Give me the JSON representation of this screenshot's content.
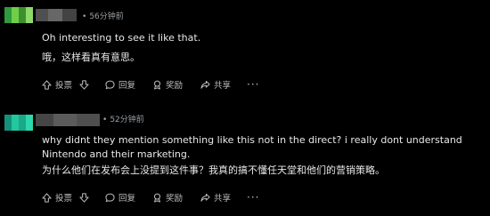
{
  "comments": [
    {
      "time": "56分钟前",
      "text_en": "Oh interesting to see it like that.",
      "text_zh": "哦，这样看真有意思。",
      "avatar_colors": [
        "#37b24d",
        "#6fcf4b",
        "#3e8f2e",
        "#8dd96a"
      ],
      "actions": {
        "upvote": "投票",
        "reply": "回复",
        "award": "奖励",
        "share": "共享",
        "more": "···"
      }
    },
    {
      "time": "52分钟前",
      "text_en": "why didnt they mention something like this not in the direct? i really dont understand Nintendo and their marketing.",
      "text_zh": "为什么他们在发布会上没提到这件事？我真的搞不懂任天堂和他们的营销策略。",
      "avatar_colors": [
        "#1aa88a",
        "#22c79e",
        "#16907a",
        "#2bd9ad"
      ],
      "actions": {
        "upvote": "投票",
        "reply": "回复",
        "award": "奖励",
        "share": "共享",
        "more": "···"
      }
    }
  ],
  "colors": {
    "background": "#000000",
    "text": "#e8e8e8",
    "muted": "#9aa0a6"
  }
}
